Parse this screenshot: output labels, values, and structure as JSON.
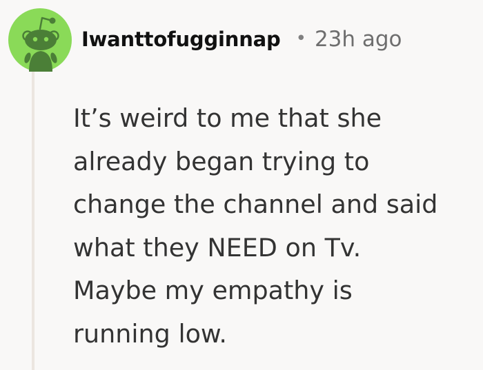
{
  "comment": {
    "author": "Iwanttofugginnap",
    "separator": "•",
    "time": "23h ago",
    "avatar_icon": "reddit-snoo-avatar-icon",
    "avatar_bg": "#8ada58",
    "avatar_fg": "#4b7f37",
    "body_lines": [
      "It’s weird to me that she",
      "already began trying to",
      "change the channel and said",
      "what they NEED on Tv.",
      "Maybe my empathy is",
      "running low."
    ]
  }
}
